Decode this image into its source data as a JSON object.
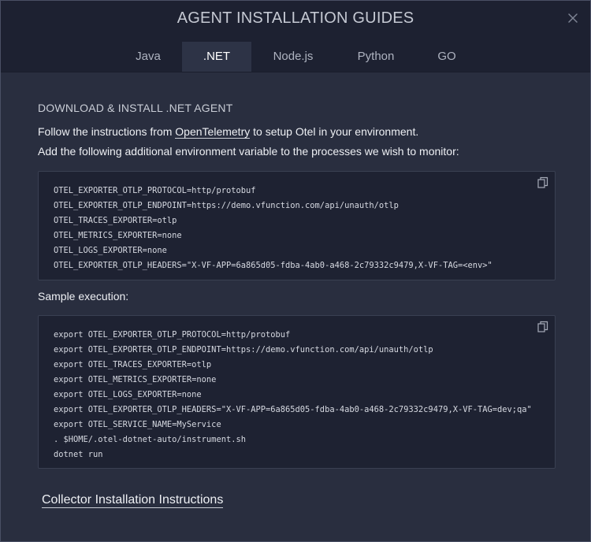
{
  "modal": {
    "title": "AGENT INSTALLATION GUIDES"
  },
  "tabs": [
    {
      "label": "Java"
    },
    {
      "label": ".NET",
      "active": true
    },
    {
      "label": "Node.js"
    },
    {
      "label": "Python"
    },
    {
      "label": "GO"
    }
  ],
  "section": {
    "title": "DOWNLOAD & INSTALL .NET AGENT",
    "line1_prefix": "Follow the instructions from ",
    "line1_link": "OpenTelemetry",
    "line1_suffix": " to setup Otel in your environment.",
    "line2": "Add the following additional environment variable to the processes we wish to monitor:"
  },
  "env_block": {
    "lines": [
      "OTEL_EXPORTER_OTLP_PROTOCOL=http/protobuf",
      "OTEL_EXPORTER_OTLP_ENDPOINT=https://demo.vfunction.com/api/unauth/otlp",
      "OTEL_TRACES_EXPORTER=otlp",
      "OTEL_METRICS_EXPORTER=none",
      "OTEL_LOGS_EXPORTER=none",
      "OTEL_EXPORTER_OTLP_HEADERS=\"X-VF-APP=6a865d05-fdba-4ab0-a468-2c79332c9479,X-VF-TAG=<env>\""
    ]
  },
  "sample": {
    "label": "Sample execution:",
    "lines": [
      "export OTEL_EXPORTER_OTLP_PROTOCOL=http/protobuf",
      "export OTEL_EXPORTER_OTLP_ENDPOINT=https://demo.vfunction.com/api/unauth/otlp",
      "export OTEL_TRACES_EXPORTER=otlp",
      "export OTEL_METRICS_EXPORTER=none",
      "export OTEL_LOGS_EXPORTER=none",
      "export OTEL_EXPORTER_OTLP_HEADERS=\"X-VF-APP=6a865d05-fdba-4ab0-a468-2c79332c9479,X-VF-TAG=dev;qa\"",
      "export OTEL_SERVICE_NAME=MyService",
      ". $HOME/.otel-dotnet-auto/instrument.sh",
      "dotnet run"
    ]
  },
  "footer": {
    "collector_link": "Collector Installation Instructions"
  },
  "icons": {
    "close": "close-icon",
    "copy": "copy-icon"
  }
}
